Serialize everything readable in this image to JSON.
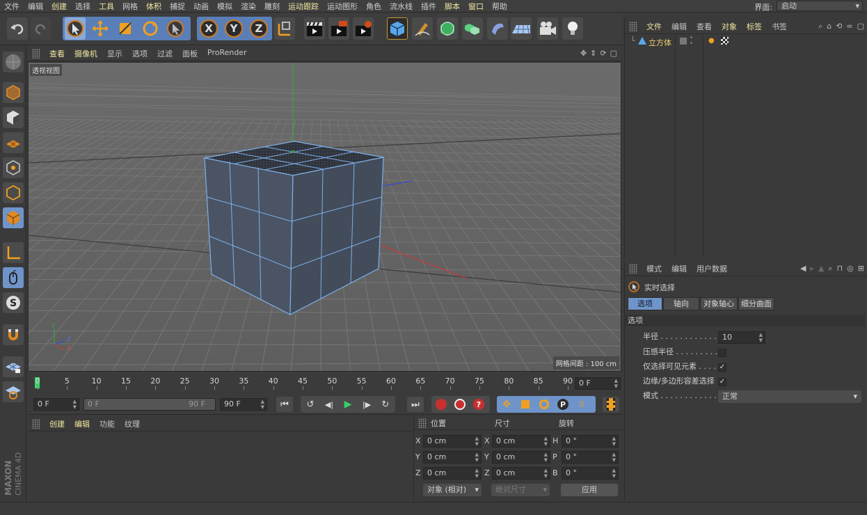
{
  "menu": {
    "items": [
      {
        "label": "文件",
        "hl": false
      },
      {
        "label": "编辑",
        "hl": false
      },
      {
        "label": "创建",
        "hl": true
      },
      {
        "label": "选择",
        "hl": false
      },
      {
        "label": "工具",
        "hl": true
      },
      {
        "label": "网格",
        "hl": false
      },
      {
        "label": "体积",
        "hl": true
      },
      {
        "label": "捕捉",
        "hl": false
      },
      {
        "label": "动画",
        "hl": false
      },
      {
        "label": "模拟",
        "hl": false
      },
      {
        "label": "渲染",
        "hl": false
      },
      {
        "label": "雕刻",
        "hl": false
      },
      {
        "label": "运动跟踪",
        "hl": true
      },
      {
        "label": "运动图形",
        "hl": false
      },
      {
        "label": "角色",
        "hl": false
      },
      {
        "label": "流水线",
        "hl": false
      },
      {
        "label": "插件",
        "hl": false
      },
      {
        "label": "脚本",
        "hl": true
      },
      {
        "label": "窗口",
        "hl": true
      },
      {
        "label": "帮助",
        "hl": false
      }
    ],
    "layout_label": "界面:",
    "layout_value": "启动"
  },
  "viewport": {
    "menu": [
      {
        "label": "查看",
        "hl": true
      },
      {
        "label": "摄像机",
        "hl": true
      },
      {
        "label": "显示",
        "hl": false
      },
      {
        "label": "选项",
        "hl": false
      },
      {
        "label": "过滤",
        "hl": false
      },
      {
        "label": "面板",
        "hl": false
      },
      {
        "label": "ProRender",
        "hl": false
      }
    ],
    "title": "透视视图",
    "grid_spacing": "网格间距 : 100 cm",
    "axis_y": "Y",
    "axis_z": "Z",
    "axis_x": "X"
  },
  "timeline": {
    "ticks": [
      "0",
      "5",
      "10",
      "15",
      "20",
      "25",
      "30",
      "35",
      "40",
      "45",
      "50",
      "55",
      "60",
      "65",
      "70",
      "75",
      "80",
      "85",
      "90"
    ],
    "end_frame": "0 F"
  },
  "transport": {
    "current": "0 F",
    "range_start": "0 F",
    "range_end": "90 F",
    "max": "90 F"
  },
  "materials": {
    "menu": [
      {
        "label": "创建",
        "hl": true
      },
      {
        "label": "编辑",
        "hl": true
      },
      {
        "label": "功能",
        "hl": false
      },
      {
        "label": "纹理",
        "hl": false
      }
    ]
  },
  "coords": {
    "headers": {
      "position": "位置",
      "size": "尺寸",
      "rotation": "旋转"
    },
    "rows": [
      {
        "a": "X",
        "pos": "0 cm",
        "b": "X",
        "size": "0 cm",
        "c": "H",
        "rot": "0 °"
      },
      {
        "a": "Y",
        "pos": "0 cm",
        "b": "Y",
        "size": "0 cm",
        "c": "P",
        "rot": "0 °"
      },
      {
        "a": "Z",
        "pos": "0 cm",
        "b": "Z",
        "size": "0 cm",
        "c": "B",
        "rot": "0 °"
      }
    ],
    "mode": "对象 (相对)",
    "size_mode": "绝对尺寸",
    "apply": "应用"
  },
  "objects": {
    "menu": [
      {
        "label": "文件",
        "hl": true
      },
      {
        "label": "编辑",
        "hl": false
      },
      {
        "label": "查看",
        "hl": false
      },
      {
        "label": "对象",
        "hl": true
      },
      {
        "label": "标签",
        "hl": true
      },
      {
        "label": "书签",
        "hl": false
      }
    ],
    "item_name": "立方体"
  },
  "attributes": {
    "menu": [
      {
        "label": "模式",
        "hl": false
      },
      {
        "label": "编辑",
        "hl": false
      },
      {
        "label": "用户数据",
        "hl": false
      }
    ],
    "tool_name": "实时选择",
    "tabs": [
      "选项",
      "轴向",
      "对象轴心",
      "细分曲面"
    ],
    "section": "选项",
    "radius_label": "半径 . . . . . . . . . . . . . .",
    "radius_value": "10",
    "pressure_label": "压感半径 . . . . . . . . . .",
    "visible_label": "仅选择可见元素 . . . . .",
    "tolerance_label": "边缘/多边形容差选择",
    "mode_label": "模式 . . . . . . . . . . . . . .",
    "mode_value": "正常"
  },
  "brand": {
    "maxon": "MAXON",
    "product": "CINEMA 4D"
  },
  "colors": {
    "accent": "#6f94c9",
    "highlight": "#f0e6a0",
    "cube": "#4a5464",
    "cube_edge": "#7eb0ea"
  }
}
